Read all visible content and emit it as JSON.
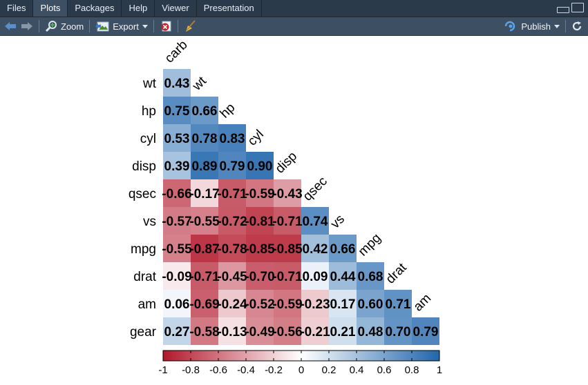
{
  "tabs": [
    {
      "label": "Files",
      "active": false
    },
    {
      "label": "Plots",
      "active": true
    },
    {
      "label": "Packages",
      "active": false
    },
    {
      "label": "Help",
      "active": false
    },
    {
      "label": "Viewer",
      "active": false
    },
    {
      "label": "Presentation",
      "active": false
    }
  ],
  "toolbar": {
    "zoom_label": "Zoom",
    "export_label": "Export",
    "publish_label": "Publish"
  },
  "colors": {
    "tabbar_bg": "#2b3a4a",
    "toolbar_bg": "#3d4f62",
    "low": "#b2182b",
    "mid": "#ffffff",
    "high": "#2166ac"
  },
  "chart_data": {
    "type": "heatmap",
    "title": "",
    "variables": [
      "carb",
      "wt",
      "hp",
      "cyl",
      "disp",
      "qsec",
      "vs",
      "mpg",
      "drat",
      "am",
      "gear"
    ],
    "rows": [
      "wt",
      "hp",
      "cyl",
      "disp",
      "qsec",
      "vs",
      "mpg",
      "drat",
      "am",
      "gear"
    ],
    "columns": [
      "carb",
      "wt",
      "hp",
      "cyl",
      "disp",
      "qsec",
      "vs",
      "mpg",
      "drat",
      "am"
    ],
    "values": [
      [
        0.43
      ],
      [
        0.75,
        0.66
      ],
      [
        0.53,
        0.78,
        0.83
      ],
      [
        0.39,
        0.89,
        0.79,
        0.9
      ],
      [
        -0.66,
        -0.17,
        -0.71,
        -0.59,
        -0.43
      ],
      [
        -0.57,
        -0.55,
        -0.72,
        -0.81,
        -0.71,
        0.74
      ],
      [
        -0.55,
        -0.87,
        -0.78,
        -0.85,
        -0.85,
        0.42,
        0.66
      ],
      [
        -0.09,
        -0.71,
        -0.45,
        -0.7,
        -0.71,
        0.09,
        0.44,
        0.68
      ],
      [
        0.06,
        -0.69,
        -0.24,
        -0.52,
        -0.59,
        -0.23,
        0.17,
        0.6,
        0.71
      ],
      [
        0.27,
        -0.58,
        -0.13,
        -0.49,
        -0.56,
        -0.21,
        0.21,
        0.48,
        0.7,
        0.79
      ]
    ],
    "labels": [
      [
        "0.43"
      ],
      [
        "0.75",
        "0.66"
      ],
      [
        "0.53",
        "0.78",
        "0.83"
      ],
      [
        "0.39",
        "0.89",
        "0.79",
        "0.90"
      ],
      [
        "-0.66",
        "-0.17",
        "-0.71",
        "-0.59",
        "-0.43"
      ],
      [
        "-0.57",
        "-0.55",
        "-0.72",
        "-0.81",
        "-0.71",
        "0.74"
      ],
      [
        "-0.55",
        "-0.87",
        "-0.78",
        "-0.85",
        "-0.85",
        "0.42",
        "0.66"
      ],
      [
        "-0.09",
        "-0.71",
        "-0.45",
        "-0.70",
        "-0.71",
        "0.09",
        "0.44",
        "0.68"
      ],
      [
        "0.06",
        "-0.69",
        "-0.24",
        "-0.52",
        "-0.59",
        "-0.23",
        "0.17",
        "0.60",
        "0.71"
      ],
      [
        "0.27",
        "-0.58",
        "-0.13",
        "-0.49",
        "-0.56",
        "-0.21",
        "0.21",
        "0.48",
        "0.70",
        "0.79"
      ]
    ],
    "legend": {
      "position": "bottom",
      "range": [
        -1,
        1
      ],
      "ticks": [
        "-1",
        "-0.8",
        "-0.6",
        "-0.4",
        "-0.2",
        "0",
        "0.2",
        "0.4",
        "0.6",
        "0.8",
        "1"
      ]
    }
  }
}
